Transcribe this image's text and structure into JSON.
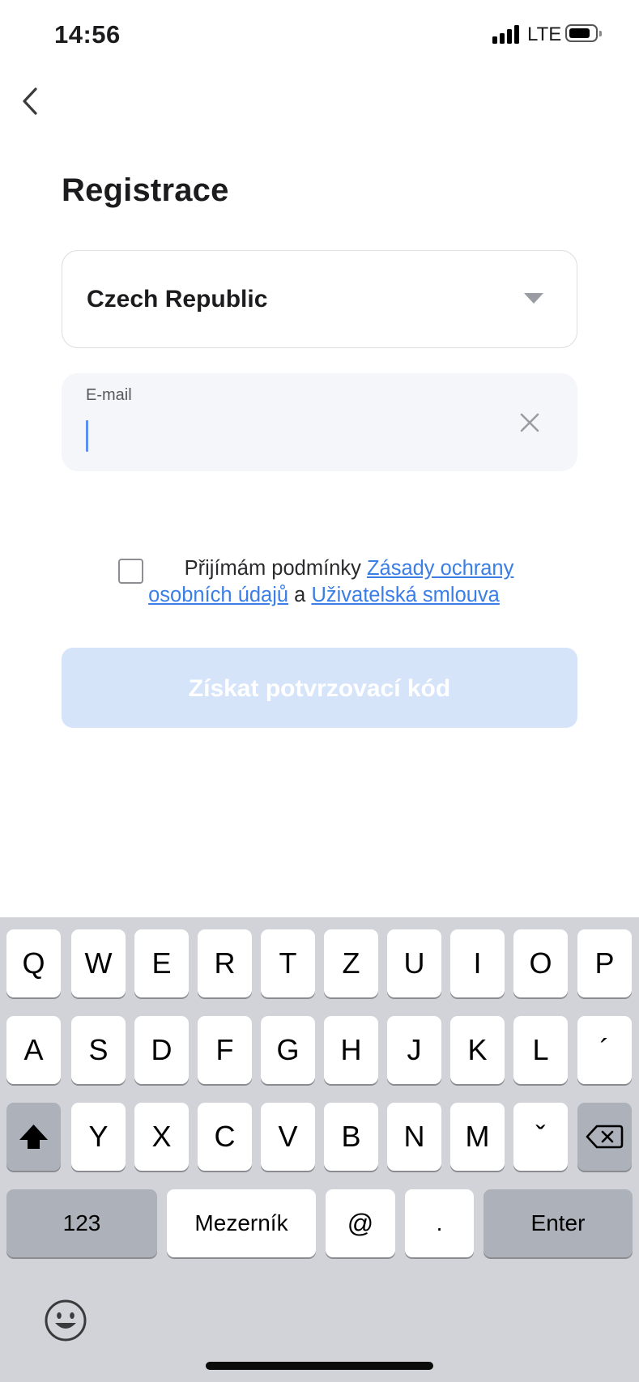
{
  "status_bar": {
    "time": "14:56",
    "network": "LTE"
  },
  "header": {
    "title": "Registrace"
  },
  "country_select": {
    "value": "Czech Republic"
  },
  "email_field": {
    "label": "E-mail",
    "value": ""
  },
  "terms": {
    "prefix": "Přijímám podmínky ",
    "privacy_link": "Zásady ochrany osobních údajů",
    "conjunction": " a ",
    "agreement_link": "Uživatelská smlouva",
    "checked": false
  },
  "submit_button": {
    "label": "Získat potvrzovací kód"
  },
  "keyboard": {
    "row1": [
      "Q",
      "W",
      "E",
      "R",
      "T",
      "Z",
      "U",
      "I",
      "O",
      "P"
    ],
    "row2": [
      "A",
      "S",
      "D",
      "F",
      "G",
      "H",
      "J",
      "K",
      "L",
      "´"
    ],
    "row3": [
      "Y",
      "X",
      "C",
      "V",
      "B",
      "N",
      "M",
      "ˇ"
    ],
    "numbers_key": "123",
    "space_key": "Mezerník",
    "at_key": "@",
    "dot_key": ".",
    "enter_key": "Enter",
    "shift_icon": "shift-icon",
    "backspace_icon": "backspace-icon",
    "emoji_icon": "emoji-icon"
  },
  "colors": {
    "accent_link": "#3a7ee6",
    "button_disabled_bg": "#d6e4fa",
    "input_bg": "#f5f6fa",
    "keyboard_bg": "#d1d3d9"
  }
}
